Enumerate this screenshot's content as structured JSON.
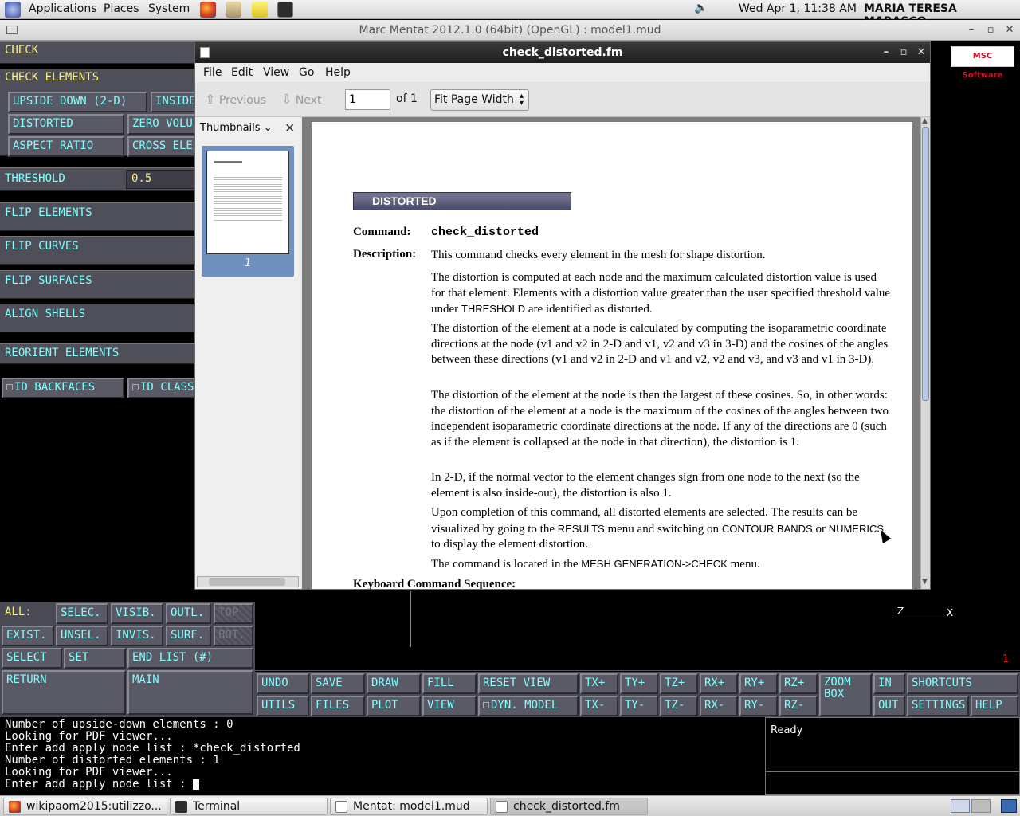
{
  "top_panel": {
    "menus": [
      "Applications",
      "Places",
      "System"
    ],
    "datetime": "Wed Apr  1, 11:38 AM",
    "user": "MARIA TERESA MARASCO"
  },
  "mentat": {
    "window_title": "Marc Mentat 2012.1.0 (64bit) (OpenGL) : model1.mud",
    "brand_logo": "MSC Software",
    "left_panel": {
      "header": "CHECK",
      "check_elements_label": "CHECK ELEMENTS",
      "upside_down": "UPSIDE DOWN (2-D)",
      "inside": "INSIDE",
      "distorted": "DISTORTED",
      "zero_volume": "ZERO VOLU",
      "aspect_ratio": "ASPECT RATIO",
      "cross_elements": "CROSS ELE",
      "threshold_label": "THRESHOLD",
      "threshold_value": "0.5",
      "flip_elements": "FLIP ELEMENTS",
      "flip_curves": "FLIP CURVES",
      "flip_surfaces": "FLIP SURFACES",
      "align_shells": "ALIGN SHELLS",
      "reorient_elements": "REORIENT ELEMENTS",
      "id_backfaces": "ID BACKFACES",
      "id_class": "ID CLASS"
    },
    "bottom_left": {
      "all_label": "ALL:",
      "selec": "SELEC.",
      "visib": "VISIB.",
      "outl": "OUTL.",
      "top": "TOP",
      "exist": "EXIST.",
      "unsel": "UNSEL.",
      "invis": "INVIS.",
      "surf": "SURF.",
      "bot": "BOT.",
      "select": "SELECT",
      "set": "SET",
      "end_list": "END LIST (#)",
      "return": "RETURN",
      "main": "MAIN"
    },
    "toolbar": {
      "undo": "UNDO",
      "save": "SAVE",
      "draw": "DRAW",
      "fill": "FILL",
      "reset_view": "RESET VIEW",
      "tx_plus": "TX+",
      "ty_plus": "TY+",
      "tz_plus": "TZ+",
      "rx_plus": "RX+",
      "ry_plus": "RY+",
      "rz_plus": "RZ+",
      "zoom_box_1": "ZOOM",
      "zoom_box_2": "BOX",
      "in": "IN",
      "shortcuts": "SHORTCUTS",
      "utils": "UTILS",
      "files": "FILES",
      "plot": "PLOT",
      "view": "VIEW",
      "dyn_model": "DYN. MODEL",
      "tx_minus": "TX-",
      "ty_minus": "TY-",
      "tz_minus": "TZ-",
      "rx_minus": "RX-",
      "ry_minus": "RY-",
      "rz_minus": "RZ-",
      "out": "OUT",
      "settings": "SETTINGS",
      "help": "HELP"
    },
    "viewport": {
      "axis_z": "Z",
      "axis_x": "X",
      "counter": "1"
    },
    "console_lines": [
      "Number of upside-down elements : 0",
      "Looking for PDF viewer...",
      "Enter add apply node list : *check_distorted",
      "Number of distorted elements : 1",
      "Looking for PDF viewer...",
      "Enter add apply node list : "
    ],
    "status": "Ready"
  },
  "pdf_viewer": {
    "title": "check_distorted.fm",
    "menus": [
      "File",
      "Edit",
      "View",
      "Go",
      "Help"
    ],
    "previous_label": "Previous",
    "next_label": "Next",
    "page_input": "1",
    "page_of": "of 1",
    "zoom_select": "Fit Page Width",
    "sidebar_mode": "Thumbnails",
    "thumbnail_page": "1",
    "document": {
      "section": "DISTORTED",
      "command_label": "Command:",
      "command_value": "check_distorted",
      "description_label": "Description:",
      "p0": "This command checks every element in the mesh for shape distortion.",
      "p1": [
        "The distortion is computed at each node and the maximum calculated distortion value",
        "is used for that element. Elements with a distortion value greater than the user",
        "specified threshold value under ",
        "THRESHOLD",
        " are identified as distorted."
      ],
      "p2": [
        "The distortion of the element at a node is calculated by computing the isoparametric",
        "coordinate directions at the node (v1 and v2 in 2-D and v1, v2 and v3 in 3-D) and the",
        "cosines of the angles between these directions (v1 and v2 in 2-D and v1 and v2, v2 and",
        "v3, and v3 and v1 in 3-D)."
      ],
      "p3": [
        "The distortion of the element at the node is then the largest of these cosines. So, in",
        "other words: the distortion of the element at a node is the maximum of the cosines of",
        "the angles between two independent isoparametric coordinate directions at the node.",
        "If any of the directions are 0 (such as if the element is collapsed at the node in that",
        "direction), the distortion is 1."
      ],
      "p4": [
        "In 2-D, if the normal vector to the element changes sign from one node to the next",
        "(so the element is also inside-out), the distortion is also 1."
      ],
      "p5": [
        "Upon completion of this command, all distorted elements are selected. The results can",
        "be visualized by going to the ",
        "RESULTS",
        " menu and switching on ",
        "CONTOUR BANDS",
        " or",
        "NUMERICS",
        " to display the element distortion."
      ],
      "p6": [
        "The command is located in the ",
        "MESH GENERATION->CHECK",
        " menu."
      ],
      "next_heading": "Keyboard Command Sequence:"
    }
  },
  "taskbar": {
    "items": [
      "wikipaom2015:utilizzo...",
      "Terminal",
      "Mentat: model1.mud",
      "check_distorted.fm"
    ]
  },
  "colors": {
    "mentat_button_text": "#7fffff",
    "mentat_label_text": "#ffef7a",
    "mentat_button_bg": "#5a5a66",
    "pdf_section_bar": "#5b5b7a"
  }
}
